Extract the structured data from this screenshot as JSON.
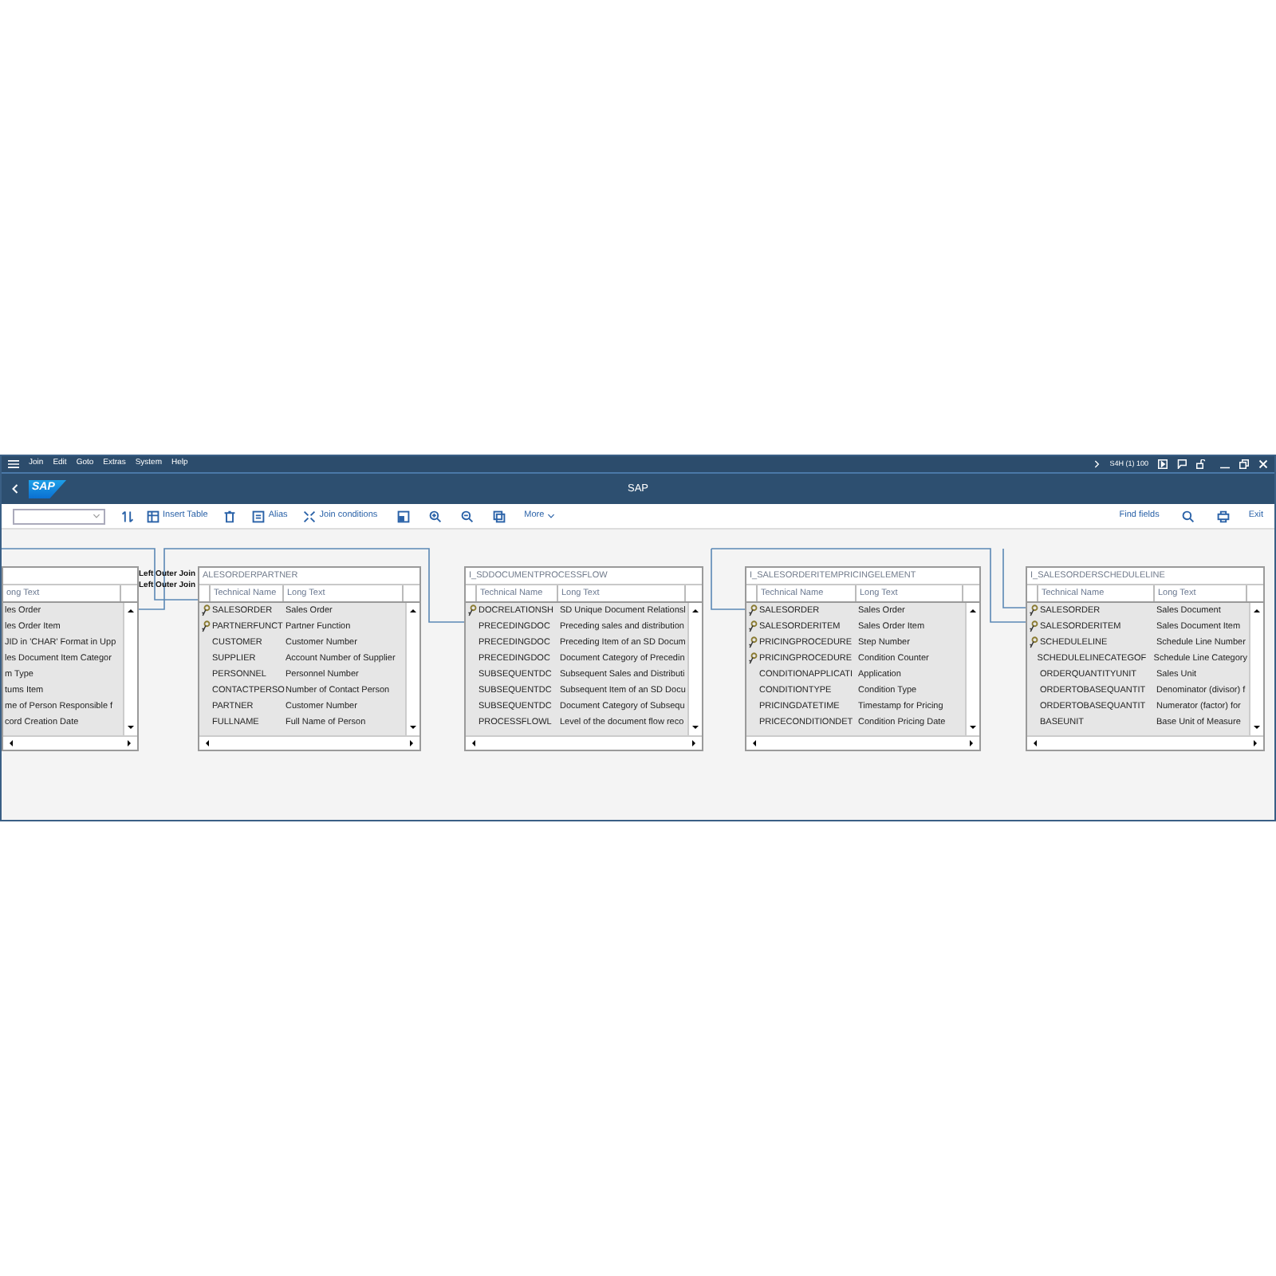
{
  "menu_bar": {
    "items": [
      "Join",
      "Edit",
      "Goto",
      "Extras",
      "System",
      "Help"
    ],
    "system": "S4H (1) 100"
  },
  "title_bar": {
    "logo": "SAP",
    "title": "SAP"
  },
  "toolbar": {
    "insert_table": "Insert Table",
    "alias": "Alias",
    "join_conditions": "Join conditions",
    "more": "More",
    "find_fields": "Find fields",
    "exit": "Exit"
  },
  "join_labels": [
    "Left Outer Join",
    "Left Outer Join"
  ],
  "tables": [
    {
      "columns": [
        "ong Text"
      ],
      "rows": [
        {
          "text": "les Order"
        },
        {
          "text": "les Order Item"
        },
        {
          "text": "JID in 'CHAR' Format in Upp"
        },
        {
          "text": "les Document Item Categor"
        },
        {
          "text": "m Type"
        },
        {
          "text": "tums Item"
        },
        {
          "text": "me of Person Responsible f"
        },
        {
          "text": "cord Creation Date"
        }
      ]
    },
    {
      "title": "ALESORDERPARTNER",
      "columns": [
        "Technical Name",
        "Long Text"
      ],
      "rows": [
        {
          "name": "SALESORDER",
          "text": "Sales Order",
          "key": true
        },
        {
          "name": "PARTNERFUNCT",
          "text": "Partner Function",
          "key": true
        },
        {
          "name": "CUSTOMER",
          "text": "Customer Number",
          "key": false
        },
        {
          "name": "SUPPLIER",
          "text": "Account Number of Supplier",
          "key": false
        },
        {
          "name": "PERSONNEL",
          "text": "Personnel Number",
          "key": false
        },
        {
          "name": "CONTACTPERSO",
          "text": "Number of Contact Person",
          "key": false
        },
        {
          "name": "PARTNER",
          "text": "Customer Number",
          "key": false
        },
        {
          "name": "FULLNAME",
          "text": "Full Name of Person",
          "key": false
        }
      ]
    },
    {
      "title": "I_SDDOCUMENTPROCESSFLOW",
      "columns": [
        "Technical Name",
        "Long Text"
      ],
      "rows": [
        {
          "name": "DOCRELATIONSH",
          "text": "SD Unique Document Relationsl",
          "key": true
        },
        {
          "name": "PRECEDINGDOC",
          "text": "Preceding sales and distribution",
          "key": false
        },
        {
          "name": "PRECEDINGDOC",
          "text": "Preceding Item of an SD Docum",
          "key": false
        },
        {
          "name": "PRECEDINGDOC",
          "text": "Document Category of Precedin",
          "key": false
        },
        {
          "name": "SUBSEQUENTDC",
          "text": "Subsequent Sales and Distributi",
          "key": false
        },
        {
          "name": "SUBSEQUENTDC",
          "text": "Subsequent Item of an SD Docu",
          "key": false
        },
        {
          "name": "SUBSEQUENTDC",
          "text": "Document Category of Subsequ",
          "key": false
        },
        {
          "name": "PROCESSFLOWL",
          "text": "Level of the document flow reco",
          "key": false
        }
      ]
    },
    {
      "title": "I_SALESORDERITEMPRICINGELEMENT",
      "columns": [
        "Technical Name",
        "Long Text"
      ],
      "rows": [
        {
          "name": "SALESORDER",
          "text": "Sales Order",
          "key": true
        },
        {
          "name": "SALESORDERITEM",
          "text": "Sales Order Item",
          "key": true
        },
        {
          "name": "PRICINGPROCEDURE",
          "text": "Step Number",
          "key": true
        },
        {
          "name": "PRICINGPROCEDURE",
          "text": "Condition Counter",
          "key": true
        },
        {
          "name": "CONDITIONAPPLICATI",
          "text": "Application",
          "key": false
        },
        {
          "name": "CONDITIONTYPE",
          "text": "Condition Type",
          "key": false
        },
        {
          "name": "PRICINGDATETIME",
          "text": "Timestamp for Pricing",
          "key": false
        },
        {
          "name": "PRICECONDITIONDET",
          "text": "Condition Pricing Date",
          "key": false
        }
      ]
    },
    {
      "title": "I_SALESORDERSCHEDULELINE",
      "columns": [
        "Technical Name",
        "Long Text"
      ],
      "rows": [
        {
          "name": "SALESORDER",
          "text": "Sales Document",
          "key": true
        },
        {
          "name": "SALESORDERITEM",
          "text": "Sales Document Item",
          "key": true
        },
        {
          "name": "SCHEDULELINE",
          "text": "Schedule Line Number",
          "key": true
        },
        {
          "name": "SCHEDULELINECATEGOF",
          "text": "Schedule Line Category",
          "key": false
        },
        {
          "name": "ORDERQUANTITYUNIT",
          "text": "Sales Unit",
          "key": false
        },
        {
          "name": "ORDERTOBASEQUANTIT",
          "text": "Denominator (divisor) f",
          "key": false
        },
        {
          "name": "ORDERTOBASEQUANTIT",
          "text": "Numerator (factor) for",
          "key": false
        },
        {
          "name": "BASEUNIT",
          "text": "Base Unit of Measure",
          "key": false
        }
      ]
    }
  ]
}
